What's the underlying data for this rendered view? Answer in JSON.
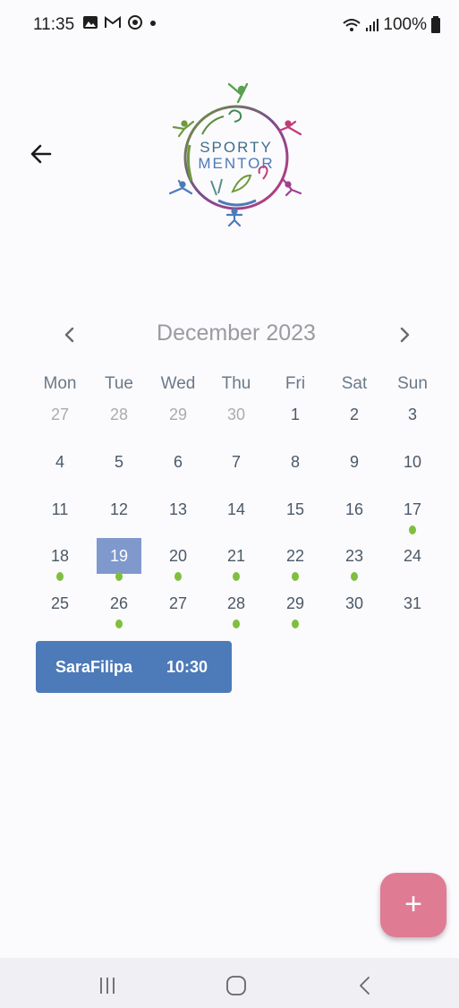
{
  "status_bar": {
    "time": "11:35",
    "battery": "100%",
    "icons": [
      "image-icon",
      "gmail-icon",
      "sync-icon",
      "dot-icon",
      "wifi-icon",
      "signal-icon",
      "battery-icon"
    ]
  },
  "header": {
    "back_icon": "arrow-left-icon",
    "logo_text": [
      "SPORTY",
      "MENTOR"
    ]
  },
  "calendar": {
    "month_label": "December 2023",
    "prev_icon": "chevron-left-icon",
    "next_icon": "chevron-right-icon",
    "weekdays": [
      "Mon",
      "Tue",
      "Wed",
      "Thu",
      "Fri",
      "Sat",
      "Sun"
    ],
    "weeks": [
      [
        {
          "d": "27",
          "muted": true
        },
        {
          "d": "28",
          "muted": true
        },
        {
          "d": "29",
          "muted": true
        },
        {
          "d": "30",
          "muted": true
        },
        {
          "d": "1"
        },
        {
          "d": "2"
        },
        {
          "d": "3"
        }
      ],
      [
        {
          "d": "4"
        },
        {
          "d": "5"
        },
        {
          "d": "6"
        },
        {
          "d": "7"
        },
        {
          "d": "8"
        },
        {
          "d": "9"
        },
        {
          "d": "10"
        }
      ],
      [
        {
          "d": "11"
        },
        {
          "d": "12"
        },
        {
          "d": "13"
        },
        {
          "d": "14"
        },
        {
          "d": "15"
        },
        {
          "d": "16"
        },
        {
          "d": "17",
          "dot": true
        }
      ],
      [
        {
          "d": "18",
          "dot": true
        },
        {
          "d": "19",
          "selected": true,
          "dot": true
        },
        {
          "d": "20",
          "dot": true
        },
        {
          "d": "21",
          "dot": true
        },
        {
          "d": "22",
          "dot": true
        },
        {
          "d": "23",
          "dot": true
        },
        {
          "d": "24"
        }
      ],
      [
        {
          "d": "25"
        },
        {
          "d": "26",
          "dot": true
        },
        {
          "d": "27"
        },
        {
          "d": "28",
          "dot": true
        },
        {
          "d": "29",
          "dot": true
        },
        {
          "d": "30"
        },
        {
          "d": "31"
        }
      ]
    ],
    "selected_color": "#7f99cc",
    "event_dot_color": "#7fbf3f"
  },
  "events": [
    {
      "name": "SaraFilipa",
      "time": "10:30"
    }
  ],
  "fab": {
    "label": "+",
    "color": "#e07b94"
  },
  "nav_bar": {
    "icons": [
      "recents-icon",
      "home-icon",
      "back-icon"
    ]
  }
}
